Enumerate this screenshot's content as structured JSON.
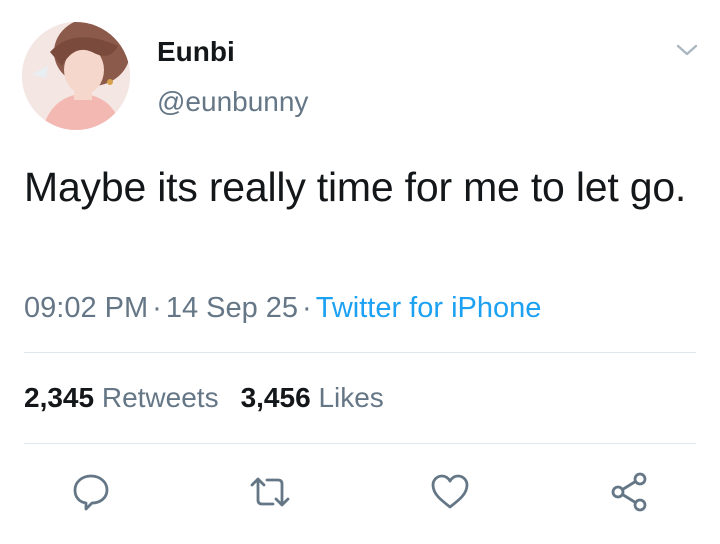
{
  "user": {
    "display_name": "Eunbi",
    "handle": "@eunbunny"
  },
  "tweet": {
    "text": "Maybe its really time for me to let go.",
    "time": "09:02 PM",
    "date": "14 Sep 25",
    "source": "Twitter for iPhone",
    "separator": "·"
  },
  "stats": {
    "retweets_count": "2,345",
    "retweets_label": "Retweets",
    "likes_count": "3,456",
    "likes_label": "Likes"
  },
  "icons": {
    "menu": "chevron-down-icon",
    "reply": "reply-icon",
    "retweet": "retweet-icon",
    "like": "heart-icon",
    "share": "share-icon"
  },
  "colors": {
    "text": "#14171a",
    "secondary": "#657786",
    "link": "#1da1f2",
    "divider": "#e1e8ed"
  }
}
